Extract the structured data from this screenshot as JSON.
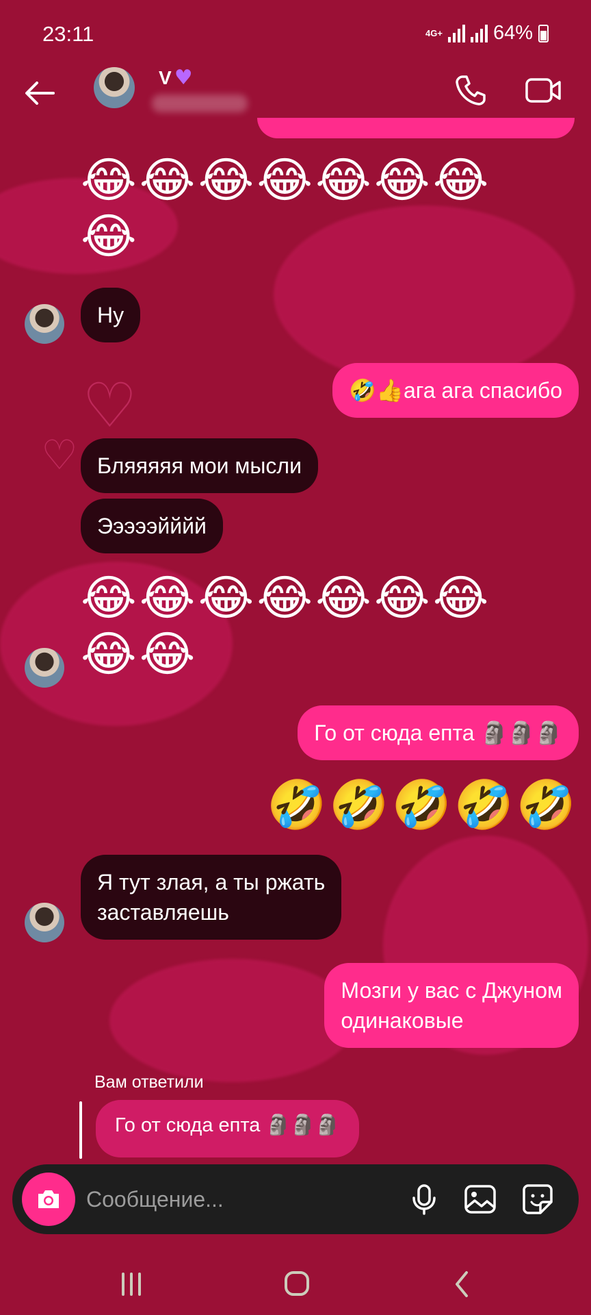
{
  "status_bar": {
    "time": "23:11",
    "network": "4G+",
    "battery": "64%"
  },
  "header": {
    "contact_name": "V",
    "name_badge_icon": "purple-heart-icon",
    "back_icon": "arrow-left-icon",
    "call_icon": "phone-icon",
    "video_icon": "video-camera-icon"
  },
  "messages": [
    {
      "from": "me",
      "type": "emoji",
      "text": "😂😂😂😂😂😂😂\n😂"
    },
    {
      "from": "them",
      "type": "text",
      "text": "Ну"
    },
    {
      "from": "me",
      "type": "text",
      "text": "🤣👍ага ага спасибо"
    },
    {
      "from": "them",
      "type": "text",
      "text": "Бляяяяя мои мысли"
    },
    {
      "from": "them",
      "type": "text",
      "text": "Эээээйййй"
    },
    {
      "from": "them",
      "type": "emoji",
      "text": "😂😂😂😂😂😂😂\n😂😂"
    },
    {
      "from": "me",
      "type": "text",
      "text": "Го от сюда епта 🗿🗿🗿"
    },
    {
      "from": "me",
      "type": "emoji",
      "text": "🤣🤣🤣🤣🤣"
    },
    {
      "from": "them",
      "type": "text",
      "text": "Я тут злая, а ты ржать\nзаставляешь"
    },
    {
      "from": "me",
      "type": "text",
      "text": "Мозги у вас с Джуном\nодинаковые"
    }
  ],
  "reply": {
    "label": "Вам ответили",
    "quoted_text": "Го от сюда епта 🗿🗿🗿"
  },
  "composer": {
    "placeholder": "Сообщение...",
    "camera_icon": "camera-icon",
    "mic_icon": "microphone-icon",
    "gallery_icon": "image-icon",
    "sticker_icon": "sticker-icon"
  },
  "nav": {
    "recents_icon": "recents-icon",
    "home_icon": "home-icon",
    "back_icon": "nav-back-icon"
  },
  "colors": {
    "background": "#9b1036",
    "outgoing_bubble": "#ff2c8c",
    "incoming_bubble": "#2b0611",
    "composer": "#1e1e1e"
  }
}
